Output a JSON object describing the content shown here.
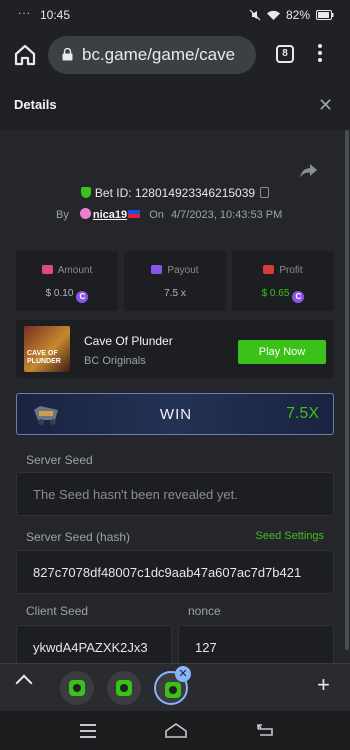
{
  "status_bar": {
    "time": "10:45",
    "battery": "82%"
  },
  "browser": {
    "url": "bc.game/game/cave",
    "tab_count": "8"
  },
  "dialog": {
    "title": "Details"
  },
  "bet": {
    "id_label": "Bet ID: 128014923346215039",
    "by_label": "By",
    "username": "nica19",
    "on_label": "On",
    "datetime": "4/7/2023, 10:43:53 PM"
  },
  "stats": [
    {
      "label": "Amount",
      "value": "$ 0.10",
      "color": "#e04a84"
    },
    {
      "label": "Payout",
      "value": "7.5 x",
      "color": "#8a55e8"
    },
    {
      "label": "Profit",
      "value": "$ 0.65",
      "color": "#d93a3a"
    }
  ],
  "game": {
    "thumb_text": "CAVE OF PLUNDER",
    "name": "Cave Of Plunder",
    "category": "BC Originals",
    "play_label": "Play Now"
  },
  "result": {
    "label": "WIN",
    "multiplier": "7.5X"
  },
  "server_seed": {
    "label": "Server Seed",
    "value": "The Seed hasn't been revealed yet."
  },
  "server_seed_hash": {
    "label": "Server Seed (hash)",
    "settings_label": "Seed Settings",
    "value": "827c7078df48007c1dc9aab47a607ac7d7b421"
  },
  "client_seed": {
    "label": "Client Seed",
    "value": "ykwdA4PAZXK2Jx3"
  },
  "nonce": {
    "label": "nonce",
    "value": "127"
  }
}
